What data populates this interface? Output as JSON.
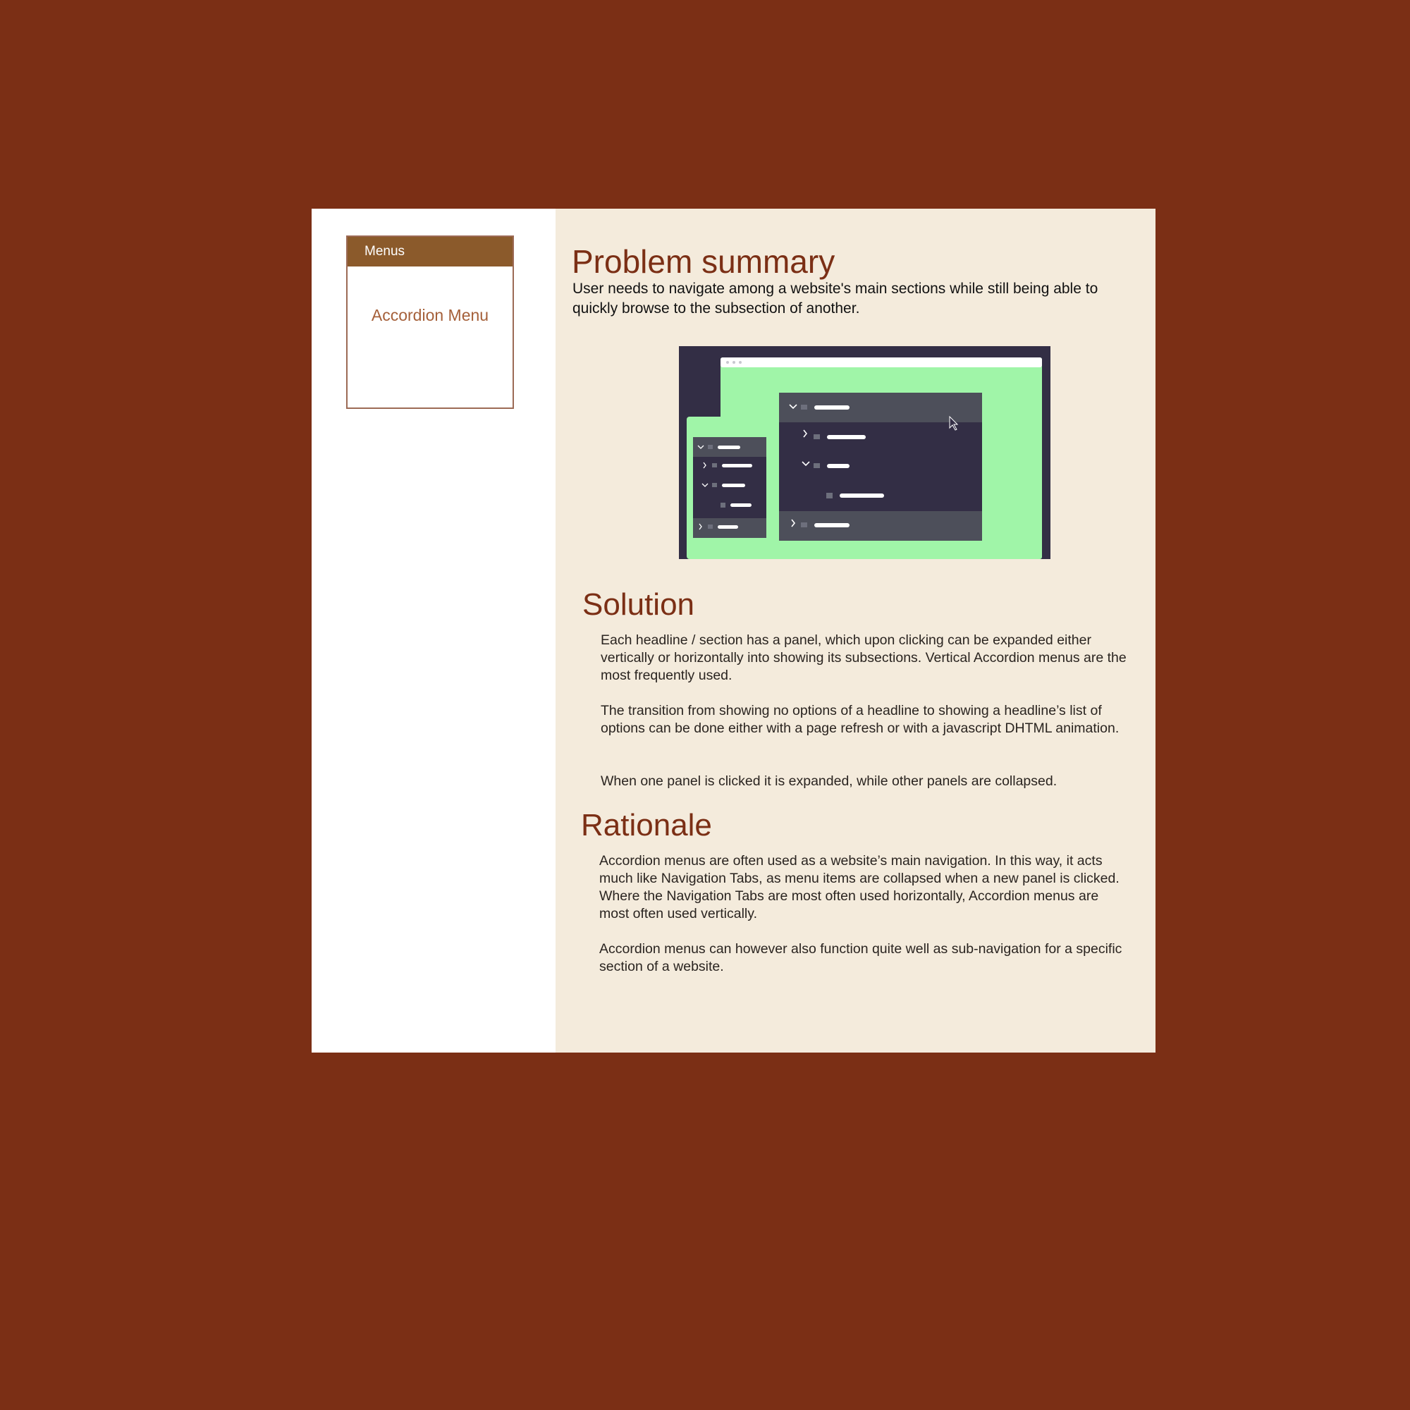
{
  "sidebar": {
    "header": "Menus",
    "link": "Accordion Menu"
  },
  "problem": {
    "title": "Problem summary",
    "text": "User needs to navigate among a website's main sections while still being able to quickly browse to the subsection of another."
  },
  "solution": {
    "title": "Solution",
    "paragraphs": [
      "Each headline / section has a panel, which upon clicking can be expanded either vertically or horizontally into showing its subsections. Vertical Accordion menus are the most frequently used.",
      "The transition from showing no options of a headline to showing a headline’s list of options can be done either with a page refresh or with a javascript DHTML animation.",
      "When one panel is clicked it is expanded, while other panels are collapsed."
    ]
  },
  "rationale": {
    "title": "Rationale",
    "paragraphs": [
      "Accordion menus are often used as a website’s main navigation. In this way, it acts much like Navigation Tabs, as menu items are collapsed when a new panel is clicked. Where the Navigation Tabs are most often used horizontally, Accordion menus are most often used vertically.",
      "Accordion menus can however also function quite well as sub-navigation for a specific section of a website."
    ]
  },
  "colors": {
    "background": "#7b2f15",
    "content_bg": "#f4ebdc",
    "heading": "#7b2f15",
    "menu_header": "#8b5a2b",
    "link": "#a5603a",
    "illustration_dark": "#332e45",
    "illustration_green": "#a0f5a8"
  },
  "illustration": {
    "icons": [
      "chevron-down-icon",
      "chevron-right-icon",
      "folder-icon",
      "file-icon",
      "cursor-icon"
    ]
  }
}
